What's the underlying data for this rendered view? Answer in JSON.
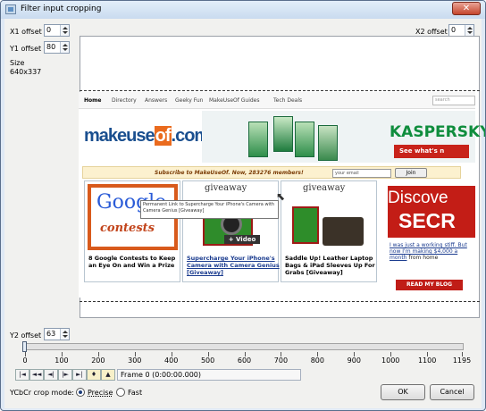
{
  "window": {
    "title": "Filter input cropping",
    "close": "✕"
  },
  "offsets": {
    "x1_label": "X1 offset",
    "x1_value": "0",
    "y1_label": "Y1 offset",
    "y1_value": "80",
    "x2_label": "X2 offset",
    "x2_value": "0",
    "y2_label": "Y2 offset",
    "y2_value": "63",
    "size_label": "Size",
    "size_value": "640x337"
  },
  "preview": {
    "nav": [
      "Home",
      "Directory",
      "Answers",
      "Geeky Fun",
      "MakeUseOf Guides",
      "Tech Deals"
    ],
    "search": "search",
    "logo_a": "makeuse",
    "logo_b": "of",
    "logo_c": ".com",
    "ad_brand": "KASPERSKY",
    "ad_cta": "See what's n",
    "subscribe": "Subscribe to MakeUseOf. Now, 283276 members!",
    "email_placeholder": "your email",
    "join": "Join",
    "card1_logo_a": "Google",
    "card1_logo_b": "contests",
    "card1_title": "8 Google Contests to Keep an Eye On and Win a Prize",
    "giveaway": "giveaway",
    "card2_badge": "+ Video",
    "card2_title": "Supercharge Your iPhone's Camera with Camera Genius [Giveaway]",
    "card3_title": "Saddle Up! Leather Laptop Bags & iPad Sleeves Up For Grabs [Giveaway]",
    "tooltip": "Permanent Link to Supercharge Your iPhone's Camera with Camera Genius [Giveaway]",
    "discover_a": "Discove",
    "discover_b": "SECR",
    "discover_text_a": "I was just a working stiff. But now I'm making $4,000 a month",
    "discover_text_b": "from home",
    "discover_btn": "READ MY BLOG"
  },
  "timeline": {
    "ticks": [
      "0",
      "100",
      "200",
      "300",
      "400",
      "500",
      "600",
      "700",
      "800",
      "900",
      "1000",
      "1100",
      "1195"
    ],
    "frame_text": "Frame 0 (0:00:00.000)",
    "position": 0
  },
  "transport": [
    "|◄",
    "◄◄",
    "◄|",
    "|►",
    "►|",
    "♦",
    "▲"
  ],
  "mode": {
    "label": "YCbCr crop mode:",
    "precise": "Precise",
    "fast": "Fast"
  },
  "buttons": {
    "ok": "OK",
    "cancel": "Cancel"
  }
}
